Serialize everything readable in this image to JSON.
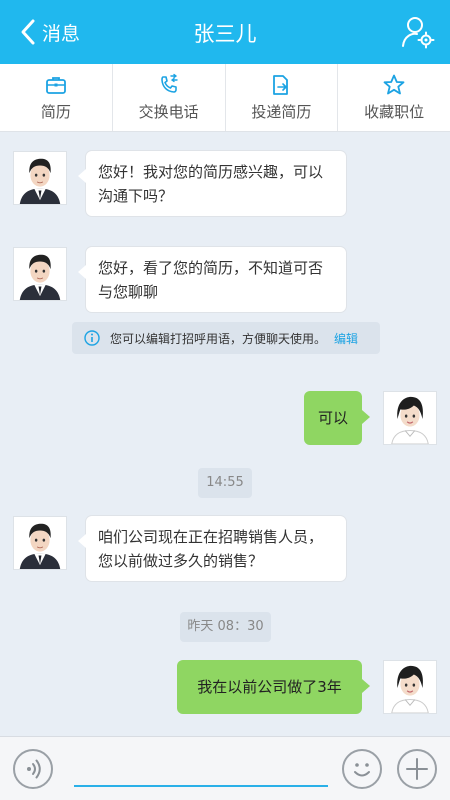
{
  "header": {
    "back_label": "消息",
    "title": "张三儿",
    "profile_icon": "user-settings-icon"
  },
  "actions": [
    {
      "label": "简历",
      "icon": "briefcase-icon"
    },
    {
      "label": "交换电话",
      "icon": "phone-exchange-icon"
    },
    {
      "label": "投递简历",
      "icon": "send-document-icon"
    },
    {
      "label": "收藏职位",
      "icon": "star-icon"
    }
  ],
  "messages": [
    {
      "side": "left",
      "lines": [
        "您好！我对您的简历感兴趣，可以",
        "沟通下吗？"
      ]
    },
    {
      "side": "left",
      "lines": [
        "您好，看了您的简历，不知道可否",
        "与您聊聊"
      ]
    },
    {
      "side": "right",
      "lines": [
        "可以"
      ]
    },
    {
      "side": "left",
      "lines": [
        "咱们公司现在正在招聘销售人员，",
        "您以前做过多久的销售？"
      ]
    },
    {
      "side": "right",
      "lines": [
        "我在以前公司做了3年"
      ]
    }
  ],
  "notice": {
    "text": "您可以编辑打招呼用语，方便聊天使用。",
    "edit_label": "编辑"
  },
  "timestamps": [
    "14:55",
    "昨天 08：30"
  ],
  "colors": {
    "header": "#20b8ee",
    "bubble_right": "#8fd662",
    "background": "#e8eef5",
    "link": "#1ca3e3"
  },
  "bottom": {
    "voice_icon": "voice-icon",
    "emoji_icon": "emoji-icon",
    "add_icon": "plus-icon"
  }
}
